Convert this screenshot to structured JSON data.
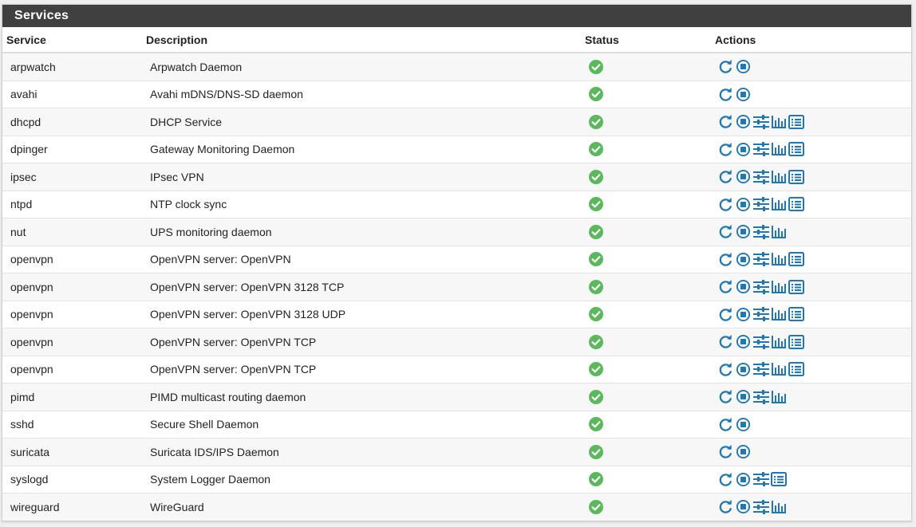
{
  "panel": {
    "title": "Services"
  },
  "columns": {
    "service": "Service",
    "description": "Description",
    "status": "Status",
    "actions": "Actions"
  },
  "colors": {
    "header_bg": "#404040",
    "icon_blue": "#1f77b4",
    "status_green": "#5cb85c"
  },
  "services": [
    {
      "name": "arpwatch",
      "description": "Arpwatch Daemon",
      "status": "running",
      "actions": [
        "restart",
        "stop"
      ]
    },
    {
      "name": "avahi",
      "description": "Avahi mDNS/DNS-SD daemon",
      "status": "running",
      "actions": [
        "restart",
        "stop"
      ]
    },
    {
      "name": "dhcpd",
      "description": "DHCP Service",
      "status": "running",
      "actions": [
        "restart",
        "stop",
        "settings",
        "status",
        "logs"
      ]
    },
    {
      "name": "dpinger",
      "description": "Gateway Monitoring Daemon",
      "status": "running",
      "actions": [
        "restart",
        "stop",
        "settings",
        "status",
        "logs"
      ]
    },
    {
      "name": "ipsec",
      "description": "IPsec VPN",
      "status": "running",
      "actions": [
        "restart",
        "stop",
        "settings",
        "status",
        "logs"
      ]
    },
    {
      "name": "ntpd",
      "description": "NTP clock sync",
      "status": "running",
      "actions": [
        "restart",
        "stop",
        "settings",
        "status",
        "logs"
      ]
    },
    {
      "name": "nut",
      "description": "UPS monitoring daemon",
      "status": "running",
      "actions": [
        "restart",
        "stop",
        "settings",
        "status"
      ]
    },
    {
      "name": "openvpn",
      "description": "OpenVPN server: OpenVPN",
      "status": "running",
      "actions": [
        "restart",
        "stop",
        "settings",
        "status",
        "logs"
      ]
    },
    {
      "name": "openvpn",
      "description": "OpenVPN server: OpenVPN 3128 TCP",
      "status": "running",
      "actions": [
        "restart",
        "stop",
        "settings",
        "status",
        "logs"
      ]
    },
    {
      "name": "openvpn",
      "description": "OpenVPN server: OpenVPN 3128 UDP",
      "status": "running",
      "actions": [
        "restart",
        "stop",
        "settings",
        "status",
        "logs"
      ]
    },
    {
      "name": "openvpn",
      "description": "OpenVPN server: OpenVPN TCP",
      "status": "running",
      "actions": [
        "restart",
        "stop",
        "settings",
        "status",
        "logs"
      ]
    },
    {
      "name": "openvpn",
      "description": "OpenVPN server: OpenVPN TCP",
      "status": "running",
      "actions": [
        "restart",
        "stop",
        "settings",
        "status",
        "logs"
      ]
    },
    {
      "name": "pimd",
      "description": "PIMD multicast routing daemon",
      "status": "running",
      "actions": [
        "restart",
        "stop",
        "settings",
        "status"
      ]
    },
    {
      "name": "sshd",
      "description": "Secure Shell Daemon",
      "status": "running",
      "actions": [
        "restart",
        "stop"
      ]
    },
    {
      "name": "suricata",
      "description": "Suricata IDS/IPS Daemon",
      "status": "running",
      "actions": [
        "restart",
        "stop"
      ]
    },
    {
      "name": "syslogd",
      "description": "System Logger Daemon",
      "status": "running",
      "actions": [
        "restart",
        "stop",
        "settings",
        "logs"
      ]
    },
    {
      "name": "wireguard",
      "description": "WireGuard",
      "status": "running",
      "actions": [
        "restart",
        "stop",
        "settings",
        "status"
      ]
    }
  ]
}
